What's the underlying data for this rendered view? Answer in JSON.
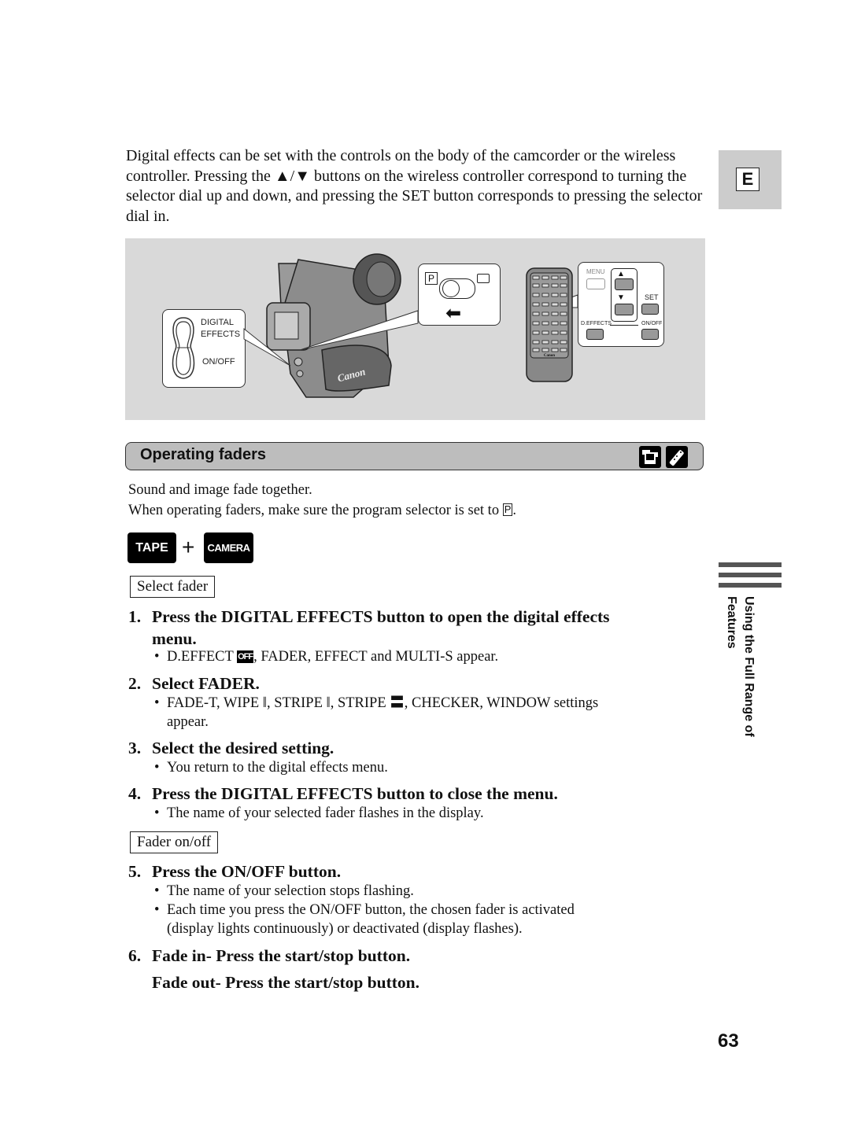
{
  "intro": {
    "text_before": "Digital effects can be set with the controls on the body of the camcorder or the wireless controller. Pressing the ",
    "arrows": "▲/▼",
    "text_after": " buttons on the wireless controller correspond to turning the selector dial up and down, and pressing the SET button corresponds to pressing the selector dial in."
  },
  "language_tab": {
    "letter": "E"
  },
  "figure": {
    "camcorder_callout": {
      "line1": "DIGITAL",
      "line2": "EFFECTS",
      "line3": "ON/OFF"
    },
    "selector_callout": {
      "p_label": "P"
    },
    "remote_brand": "Canon",
    "remote_callout": {
      "menu": "MENU",
      "set": "SET",
      "deffects": "D.EFFECTS",
      "onoff": "ON/OFF"
    }
  },
  "section": {
    "title": "Operating faders",
    "icons": [
      "camcorder-icon",
      "remote-icon"
    ]
  },
  "description": {
    "line1": "Sound and image fade together.",
    "line2": "When operating faders, make sure the program selector is set to ",
    "p_symbol": "P",
    "line2_end": "."
  },
  "modes": {
    "tape": "TAPE",
    "plus": "+",
    "camera": "CAMERA"
  },
  "labels": {
    "select_fader": "Select fader",
    "fader_onoff": "Fader on/off"
  },
  "steps": [
    {
      "num": "1.",
      "line1": "Press the DIGITAL EFFECTS button to open the digital effects",
      "line2": "menu."
    },
    {
      "num": "2.",
      "text": "Select FADER."
    },
    {
      "num": "3.",
      "text": "Select the desired setting."
    },
    {
      "num": "4.",
      "text": "Press the DIGITAL EFFECTS button to close the menu."
    },
    {
      "num": "5.",
      "text": "Press the ON/OFF button."
    },
    {
      "num": "6.",
      "line1": "Fade in- Press the start/stop button.",
      "line2": "Fade out- Press the start/stop button."
    }
  ],
  "bullets": {
    "s1_a_before": "D.EFFECT ",
    "s1_a_off": "OFF",
    "s1_a_after": ", FADER, EFFECT and MULTI-S appear.",
    "s2_a_line1": "FADE-T, WIPE ǁ, STRIPE ǁ, STRIPE 〓, CHECKER, WINDOW settings",
    "s2_a_line2": "appear.",
    "s3_a": "You return to the digital effects menu.",
    "s4_a": "The name of your selected fader flashes in the display.",
    "s5_a": "The name of your selection stops flashing.",
    "s5_b_line1": "Each time you press the ON/OFF button, the chosen fader is activated",
    "s5_b_line2": "(display lights continuously) or deactivated (display flashes).",
    "dot": "•"
  },
  "side": {
    "label": "Using the Full Range of Features"
  },
  "page_number": "63"
}
